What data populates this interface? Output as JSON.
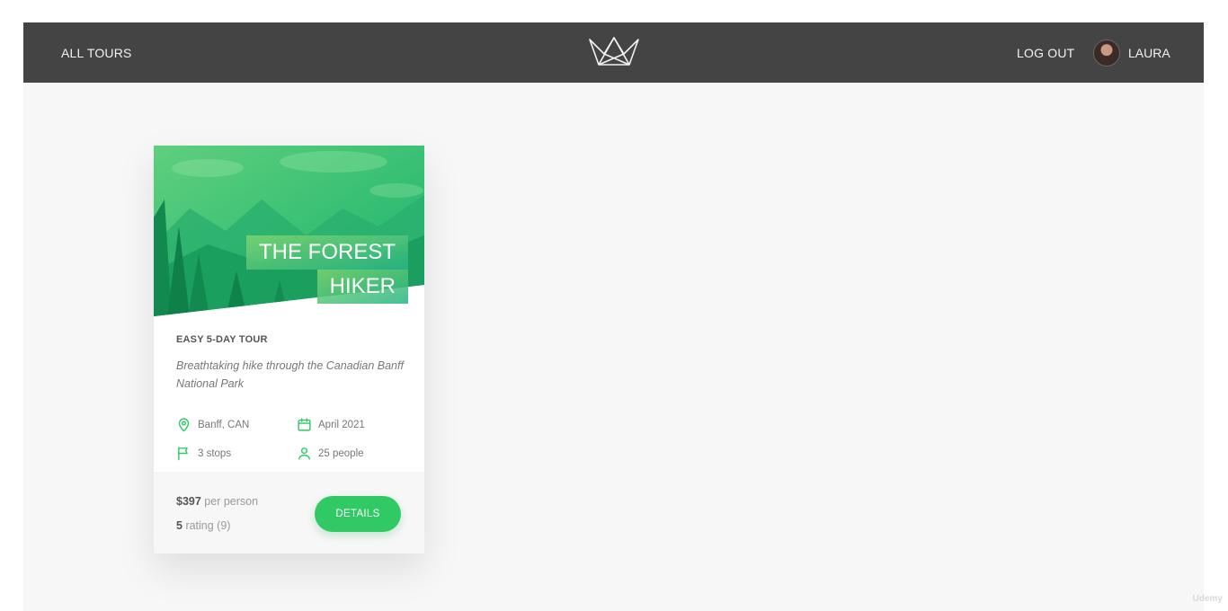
{
  "header": {
    "all_tours": "All tours",
    "logout": "Log out",
    "user_name": "Laura",
    "logo_icon": "natours-crown-logo"
  },
  "card": {
    "title_line1": "The Forest",
    "title_line2": "Hiker",
    "subtitle": "Easy 5-day tour",
    "summary": "Breathtaking hike through the Canadian Banff National Park",
    "location": "Banff, CAN",
    "date": "April 2021",
    "stops": "3 stops",
    "people": "25 people",
    "price_value": "$397",
    "price_unit": "per person",
    "rating_value": "5",
    "rating_text": "rating (9)",
    "details_button": "Details",
    "icons": [
      "map-pin-icon",
      "calendar-icon",
      "flag-icon",
      "user-icon"
    ]
  },
  "colors": {
    "header_bg": "#444444",
    "accent_green": "#30c964",
    "page_bg": "#f7f7f7"
  },
  "watermark": "Udemy"
}
